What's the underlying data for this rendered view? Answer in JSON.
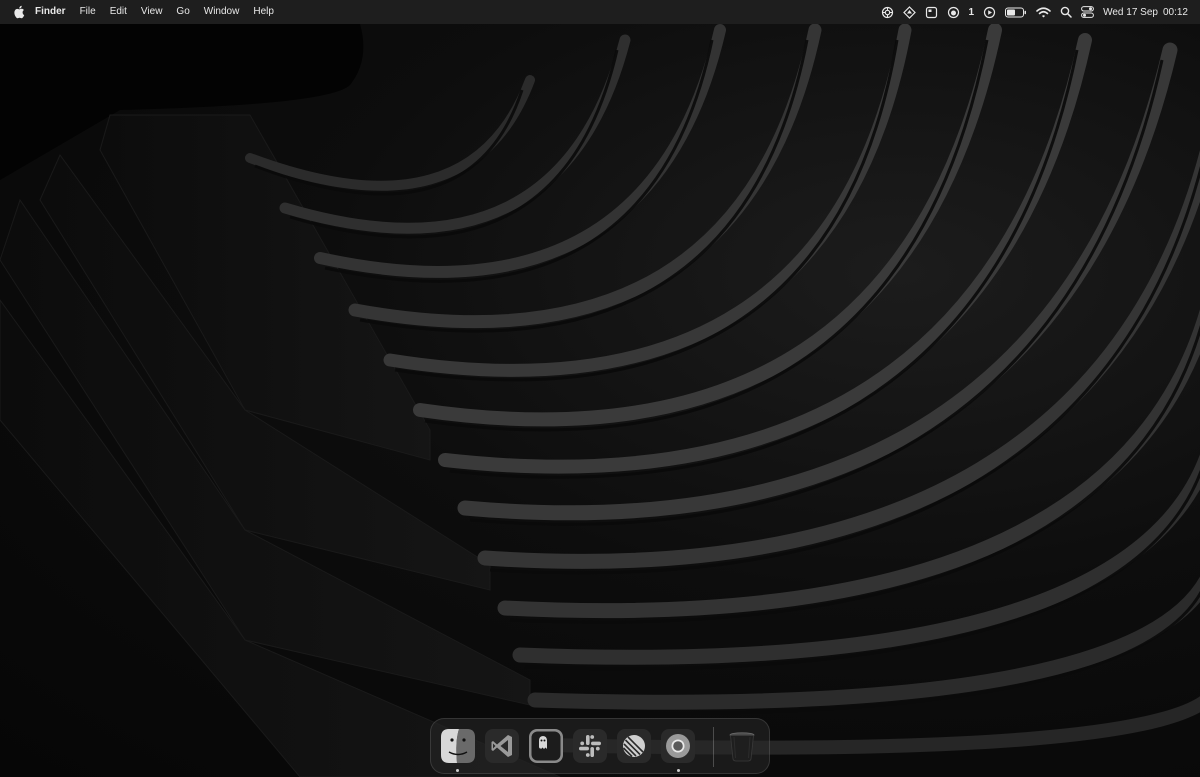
{
  "menubar": {
    "apple_icon": "apple-logo-icon",
    "app_name": "Finder",
    "menus": [
      "File",
      "Edit",
      "View",
      "Go",
      "Window",
      "Help"
    ],
    "status_icons": [
      "openai-icon",
      "navigation-arrow-icon",
      "window-icon",
      "focus-icon",
      "play-circle-icon",
      "battery-icon",
      "wifi-icon",
      "search-icon",
      "control-center-icon"
    ],
    "notification_count": "1",
    "date": "Wed 17 Sep",
    "time": "00:12"
  },
  "dock": {
    "apps": [
      {
        "name": "Finder",
        "icon": "finder-icon",
        "running": true
      },
      {
        "name": "Visual Studio Code",
        "icon": "vscode-icon",
        "running": false
      },
      {
        "name": "Ghostty",
        "icon": "ghost-terminal-icon",
        "running": false
      },
      {
        "name": "Slack",
        "icon": "slack-icon",
        "running": false
      },
      {
        "name": "Linear",
        "icon": "linear-icon",
        "running": false
      },
      {
        "name": "Chrome",
        "icon": "chrome-icon",
        "running": true
      }
    ],
    "trash": {
      "name": "Trash",
      "icon": "trash-icon"
    }
  },
  "colors": {
    "menubar_bg": "#1e1e1e",
    "menubar_text": "#e8e8e8",
    "wallpaper_base": "#0a0a0a"
  }
}
